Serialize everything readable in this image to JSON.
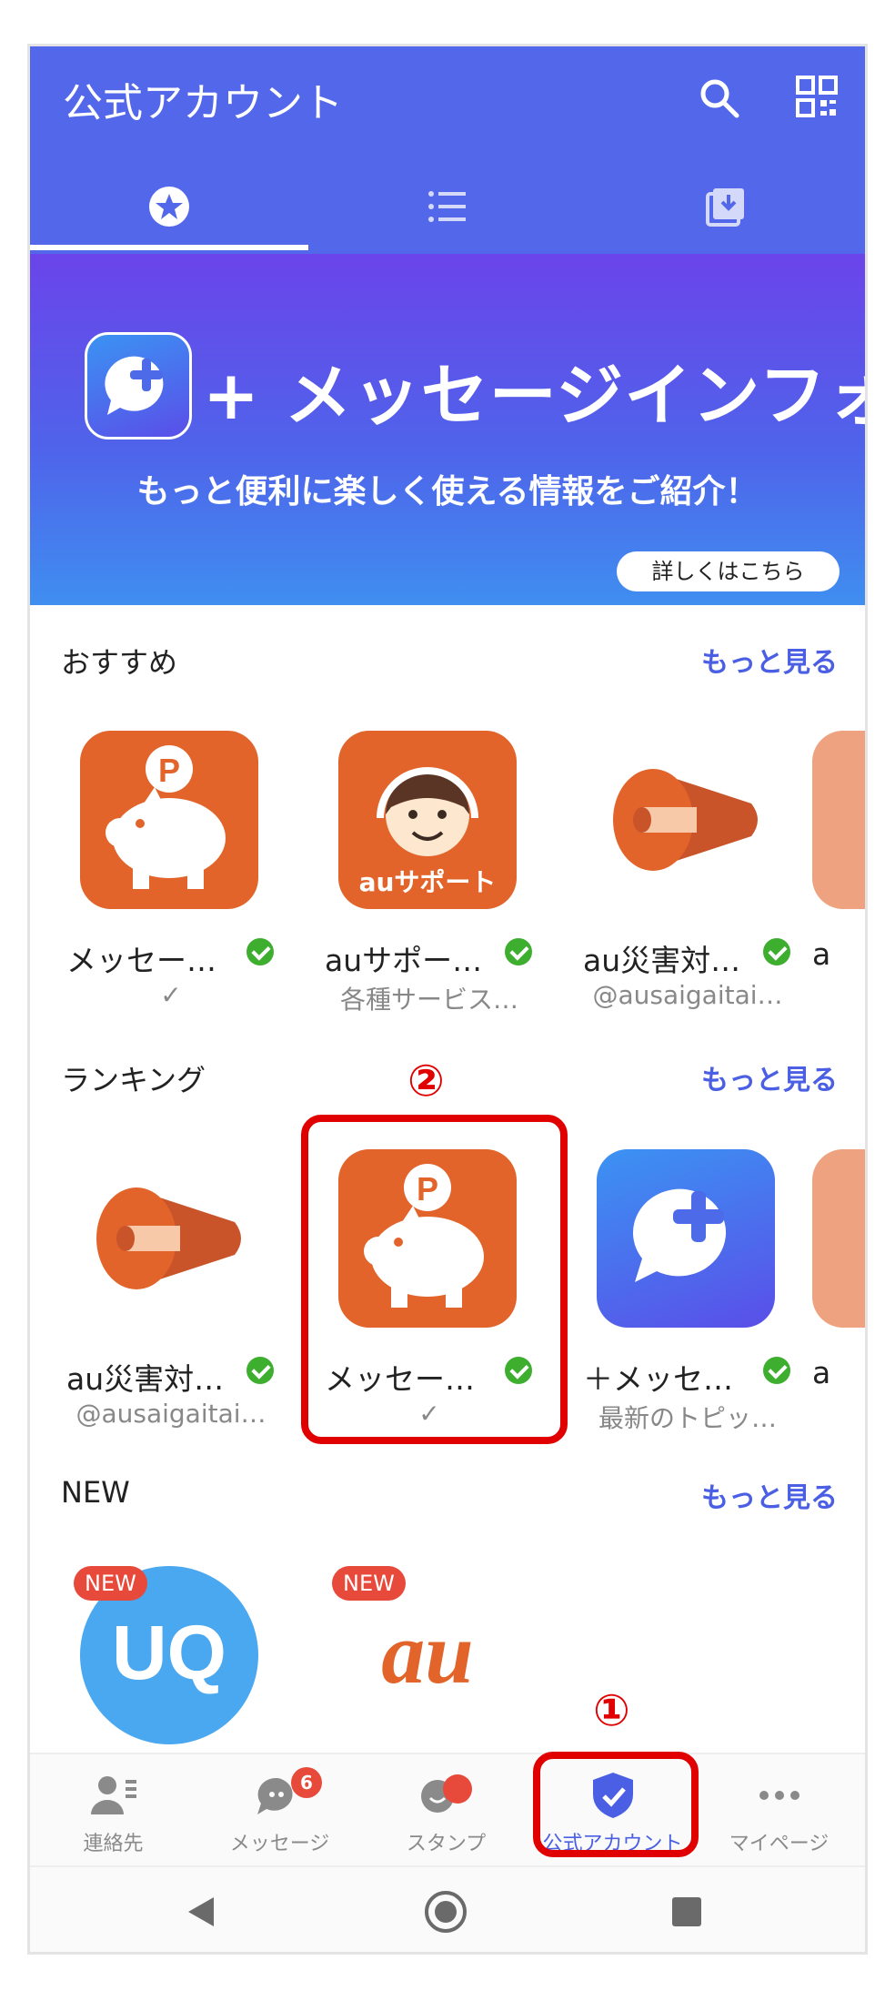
{
  "header": {
    "title": "公式アカウント",
    "icons": [
      "search-icon",
      "qr-code-icon"
    ],
    "tabs": [
      "star-icon",
      "list-icon",
      "download-icon"
    ],
    "color": "#5367ea"
  },
  "banner": {
    "title": "+ メッセージインフォ",
    "subtitle": "もっと便利に楽しく使える情報をご紹介！",
    "button": "詳しくはこちら"
  },
  "sections": {
    "recommended": {
      "title": "おすすめ",
      "more": "もっと見る",
      "cards": [
        {
          "name": "メッセー…",
          "sub": "✓",
          "icon": "piggy-bank-icon"
        },
        {
          "name": "auサポー…",
          "sub": "各種サービス…",
          "icon": "au-support-icon",
          "logo_text": "auサポート"
        },
        {
          "name": "au災害対…",
          "sub": "@ausaigaitai…",
          "icon": "megaphone-icon"
        },
        {
          "name": "a",
          "sub": "",
          "icon": "partial-icon"
        }
      ]
    },
    "ranking": {
      "title": "ランキング",
      "more": "もっと見る",
      "cards": [
        {
          "name": "au災害対…",
          "sub": "@ausaigaitai…",
          "icon": "megaphone-icon"
        },
        {
          "name": "メッセー…",
          "sub": "✓",
          "icon": "piggy-bank-icon"
        },
        {
          "name": "＋メッセ…",
          "sub": "最新のトピッ…",
          "icon": "plus-message-icon"
        },
        {
          "name": "a",
          "sub": "",
          "icon": "partial-icon"
        }
      ]
    },
    "new": {
      "title": "NEW",
      "more": "もっと見る",
      "badge": "NEW",
      "items": [
        {
          "icon": "uq-logo-icon",
          "logo_text": "UQ"
        },
        {
          "icon": "au-logo-icon",
          "logo_text": "au"
        }
      ]
    }
  },
  "bottom_nav": [
    {
      "label": "連絡先",
      "icon": "contacts-icon"
    },
    {
      "label": "メッセージ",
      "icon": "message-icon",
      "badge": "6"
    },
    {
      "label": "スタンプ",
      "icon": "stamp-icon"
    },
    {
      "label": "公式アカウント",
      "icon": "shield-check-icon",
      "active": true
    },
    {
      "label": "マイページ",
      "icon": "more-icon"
    }
  ],
  "annotations": {
    "marker_1": "①",
    "marker_2": "②",
    "color": "#e00000"
  }
}
